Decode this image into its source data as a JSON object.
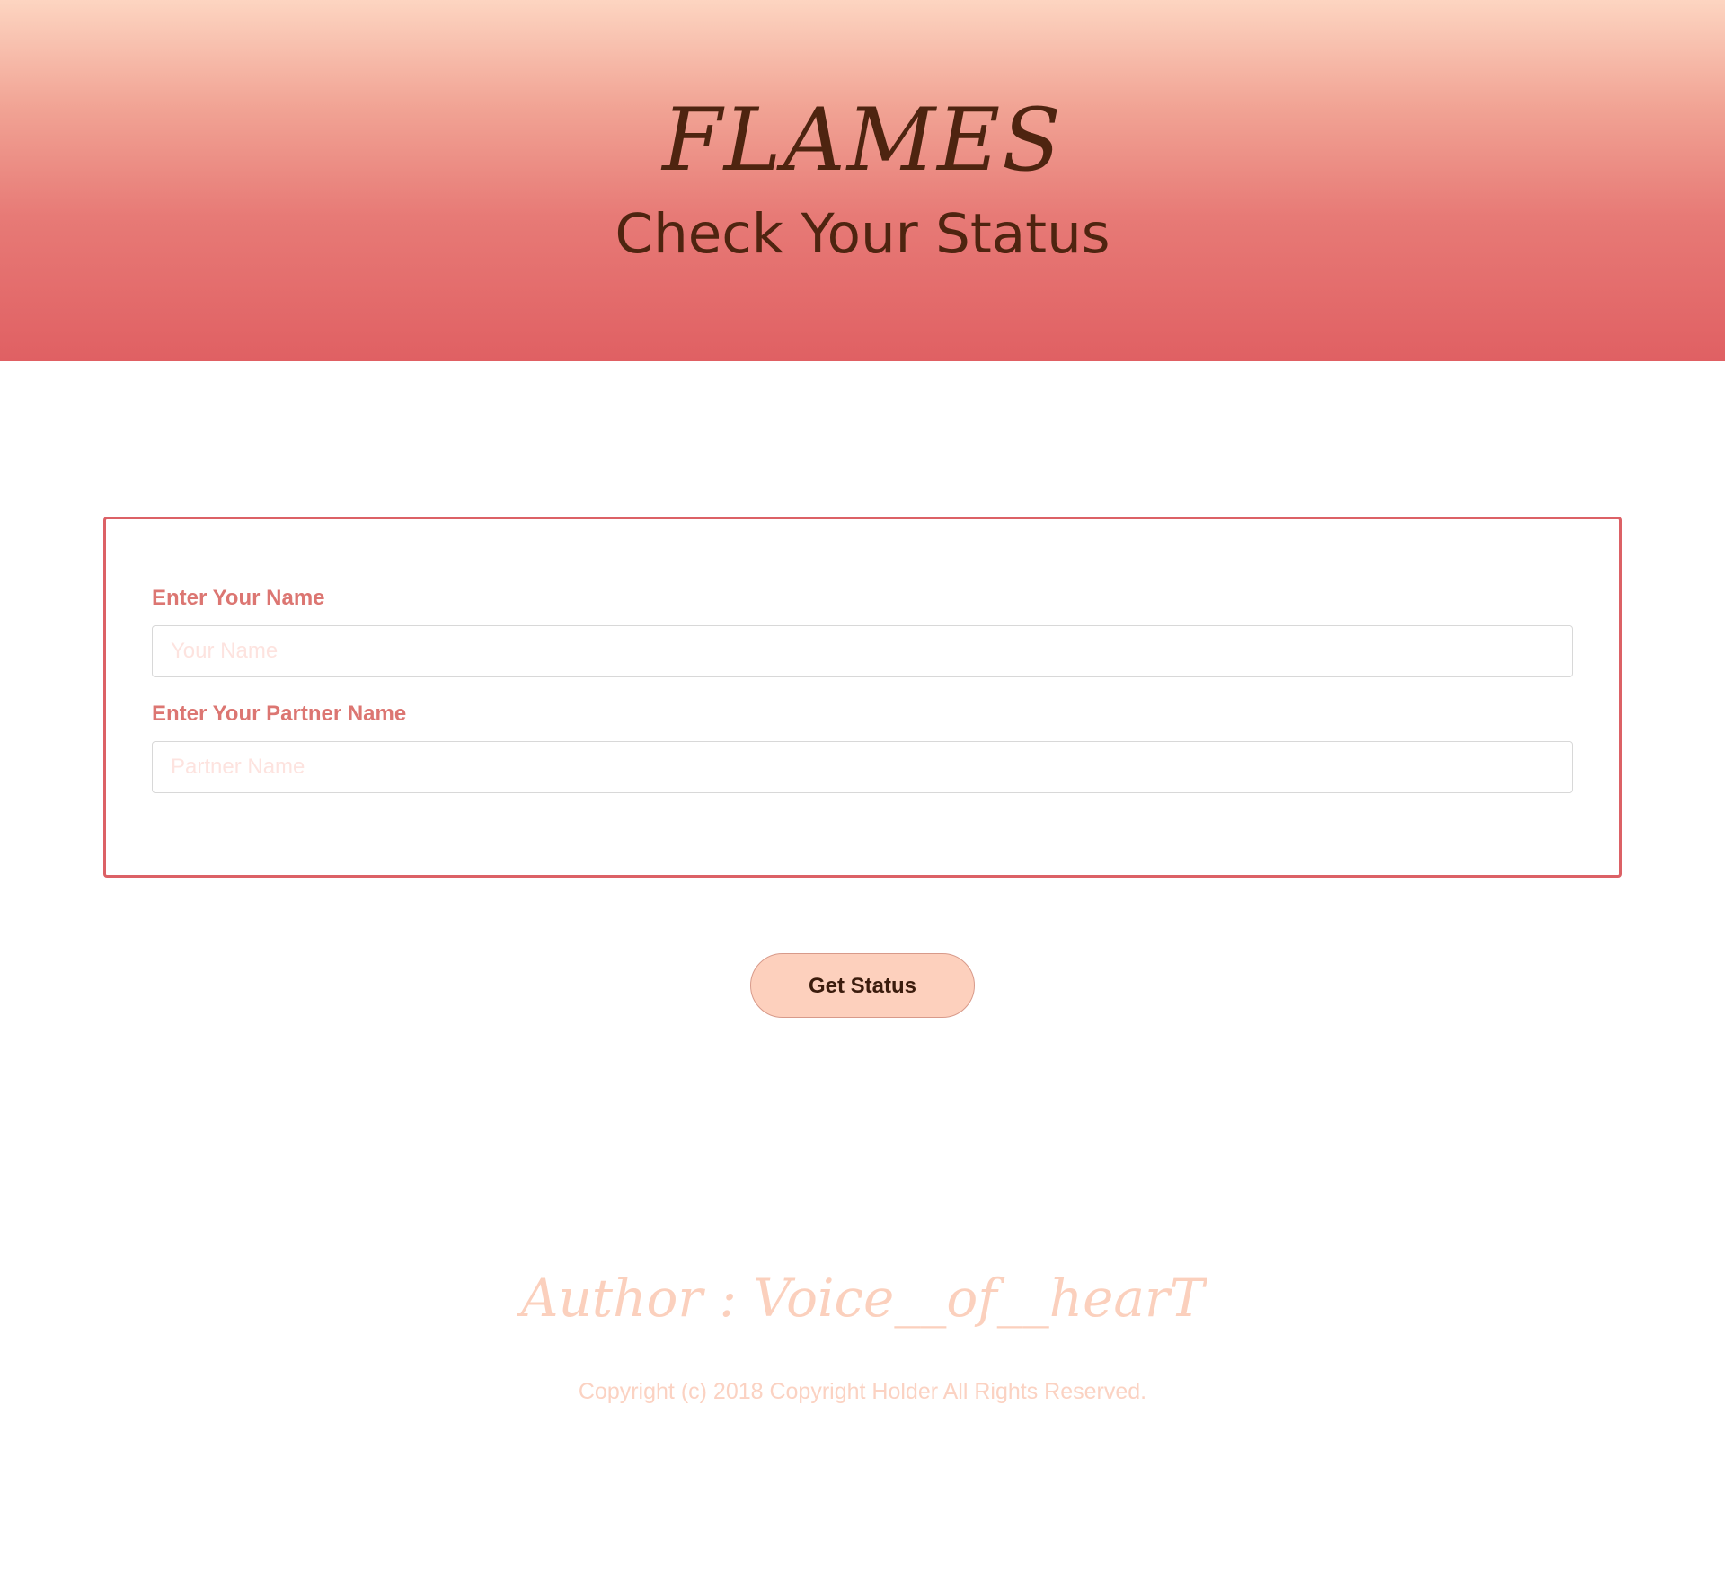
{
  "header": {
    "title": "FLAMES",
    "subtitle": "Check Your Status"
  },
  "form": {
    "name_label": "Enter Your Name",
    "name_placeholder": "Your Name",
    "name_value": "",
    "partner_label": "Enter Your Partner Name",
    "partner_placeholder": "Partner Name",
    "partner_value": ""
  },
  "actions": {
    "get_status_label": "Get Status"
  },
  "footer": {
    "author": "Author : Voice__of__hearT",
    "copyright": "Copyright (c) 2018 Copyright Holder All Rights Reserved."
  },
  "colors": {
    "header_gradient_top": "#fdd5c1",
    "header_gradient_bottom": "#e06063",
    "accent": "#dc6166",
    "title_text": "#4e2410",
    "button_bg": "#fdd0bd",
    "footer_text": "#fbd0bd"
  }
}
